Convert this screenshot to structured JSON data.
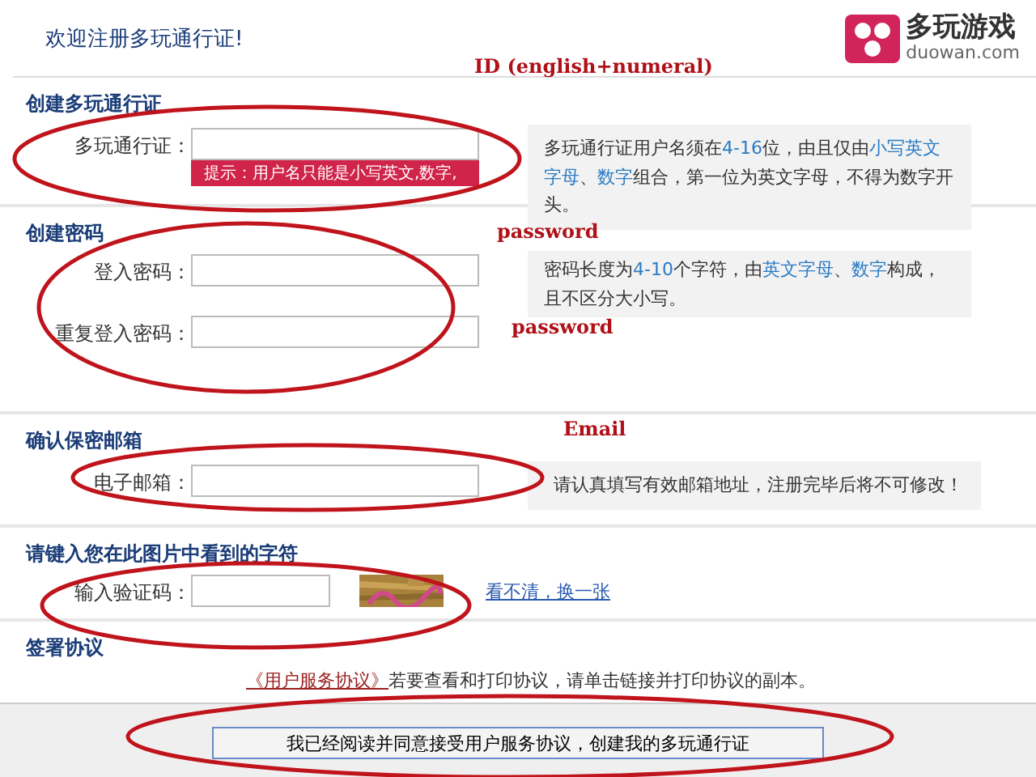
{
  "header": {
    "title": "欢迎注册多玩通行证!",
    "logo_name": "多玩游戏",
    "logo_domain": "duowan.com"
  },
  "sections": [
    {
      "kind": "username",
      "title": "创建多玩通行证",
      "fields": [
        {
          "label": "多玩通行证："
        }
      ],
      "tooltip": "提示：用户名只能是小写英文,数字,",
      "hint": [
        {
          "text": "多玩通行证用户名须在",
          "highlight": false
        },
        {
          "text": "4-16",
          "highlight": true
        },
        {
          "text": "位，由且仅由",
          "highlight": false
        },
        {
          "text": "小写英文字母",
          "highlight": true
        },
        {
          "text": "、",
          "highlight": false
        },
        {
          "text": "数字",
          "highlight": true
        },
        {
          "text": "组合，第一位为英文字母，不得为数字开头。",
          "highlight": false
        }
      ]
    },
    {
      "kind": "password",
      "title": "创建密码",
      "fields": [
        {
          "label": "登入密码："
        },
        {
          "label": "重复登入密码："
        }
      ],
      "hint": [
        {
          "text": "密码长度为",
          "highlight": false
        },
        {
          "text": "4-10",
          "highlight": true
        },
        {
          "text": "个字符，由",
          "highlight": false
        },
        {
          "text": "英文字母",
          "highlight": true
        },
        {
          "text": "、",
          "highlight": false
        },
        {
          "text": "数字",
          "highlight": true
        },
        {
          "text": "构成，且不区分大小写。",
          "highlight": false
        }
      ]
    },
    {
      "kind": "email",
      "title": "确认保密邮箱",
      "fields": [
        {
          "label": "电子邮箱："
        }
      ],
      "hint": [
        {
          "text": "请认真填写有效邮箱地址，注册完毕后将不可修改！",
          "highlight": false
        }
      ]
    },
    {
      "kind": "captcha",
      "title": "请键入您在此图片中看到的字符",
      "fields": [
        {
          "label": "输入验证码："
        }
      ],
      "refresh_link": "看不清，换一张"
    },
    {
      "kind": "agreement",
      "title": "签署协议",
      "agreement_link": "《用户服务协议》",
      "agreement_text": "若要查看和打印协议，请单击链接并打印协议的副本。"
    }
  ],
  "submit_button": "我已经阅读并同意接受用户服务协议，创建我的多玩通行证",
  "annotations": [
    {
      "text": "ID (english+numeral)"
    },
    {
      "text": "password"
    },
    {
      "text": "password"
    },
    {
      "text": "Email"
    }
  ]
}
